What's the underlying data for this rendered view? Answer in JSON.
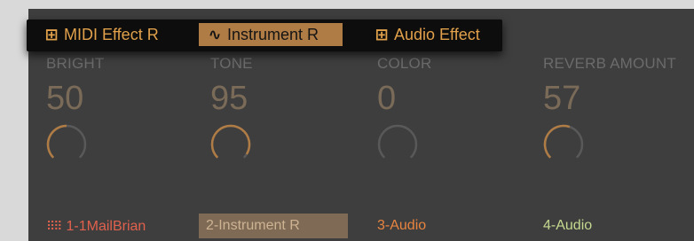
{
  "tabs": [
    {
      "label": "MIDI Effect R",
      "icon": "midi-rack-icon",
      "active": false
    },
    {
      "label": "Instrument R",
      "icon": "instrument-rack-icon",
      "active": true
    },
    {
      "label": "Audio Effect",
      "icon": "audio-rack-icon",
      "active": false
    }
  ],
  "macros": [
    {
      "label": "BRIGHT",
      "value": "50",
      "level": 0.5
    },
    {
      "label": "TONE",
      "value": "95",
      "level": 0.95
    },
    {
      "label": "COLOR",
      "value": "0",
      "level": 0.0
    },
    {
      "label": "REVERB AMOUNT",
      "value": "57",
      "level": 0.57
    }
  ],
  "chains": [
    {
      "label": "1-1MailBrian",
      "color": "#e0614d"
    },
    {
      "label": "2-Instrument R",
      "color": "#cdb392"
    },
    {
      "label": "3-Audio",
      "color": "#e8843f"
    },
    {
      "label": "4-Audio",
      "color": "#c5d98f"
    }
  ],
  "colors": {
    "accent": "#b07c45",
    "tab_text": "#e1a14b",
    "panel_bg": "#3e3e3e",
    "knob_track": "#595959",
    "knob_fill": "#b07c45"
  }
}
